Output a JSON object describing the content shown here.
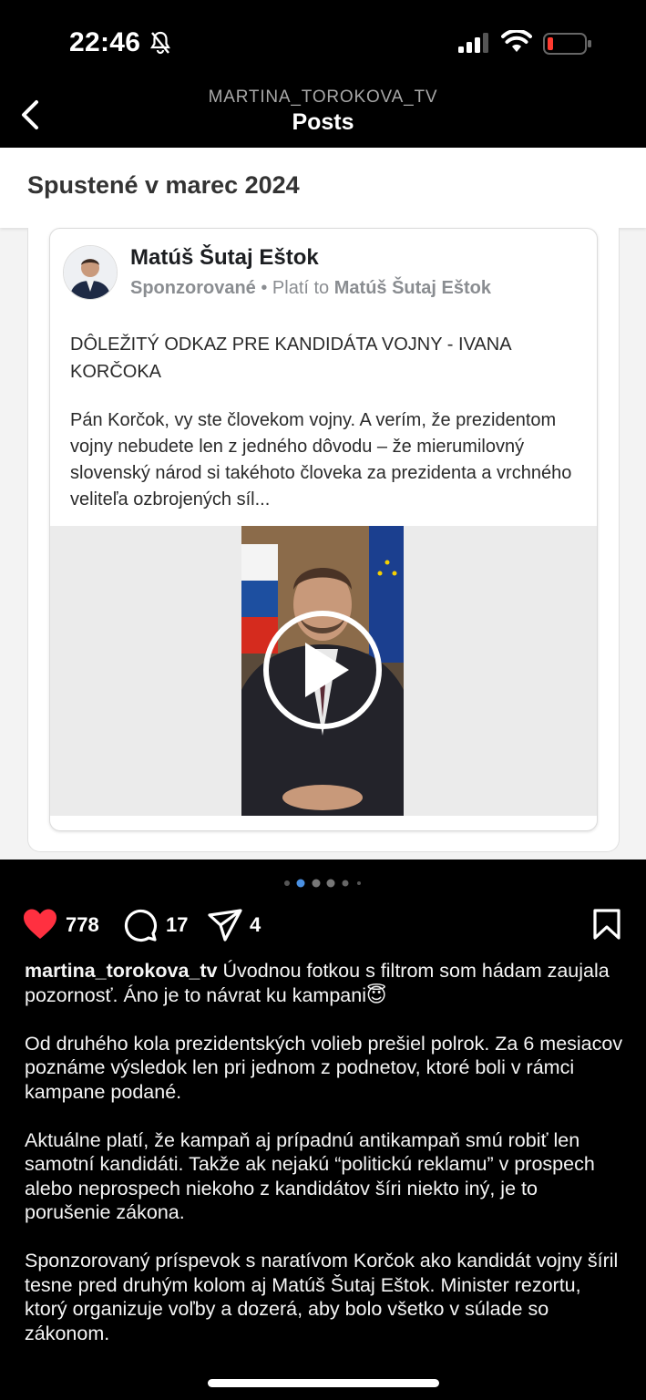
{
  "status_bar": {
    "time": "22:46"
  },
  "header": {
    "account": "MARTINA_TOROKOVA_TV",
    "title": "Posts"
  },
  "ad_preview": {
    "launched_label": "Spustené v marec 2024",
    "advertiser": "Matúš Šutaj Eštok",
    "sponsored": "Sponzorované",
    "paid_by_prefix": "• Platí to",
    "paid_by": "Matúš Šutaj Eštok",
    "headline": "DÔLEŽITÝ ODKAZ PRE KANDIDÁTA VOJNY - IVANA KORČOKA",
    "body": "Pán Korčok, vy ste človekom vojny. A verím, že prezidentom vojny nebudete len z jedného dôvodu – že mierumilovný slovenský národ si takéhoto človeka za prezidenta a vrchného veliteľa ozbrojených síl..."
  },
  "carousel": {
    "total": 6,
    "active_index": 1
  },
  "actions": {
    "likes": "778",
    "comments": "17",
    "shares": "4"
  },
  "caption": {
    "username": "martina_torokova_tv",
    "first_text": "Úvodnou fotkou s filtrom som hádam zaujala pozornosť. Áno je to návrat ku kampani😇",
    "paragraphs": [
      "Od druhého kola prezidentských volieb prešiel polrok. Za 6 mesiacov poznáme výsledok len pri jednom z podnetov, ktoré boli v rámci kampane podané.",
      "Aktuálne platí, že kampaň aj prípadnú antikampaň smú robiť len samotní kandidáti. Takže ak nejakú “politickú reklamu” v prospech alebo neprospech niekoho z kandidátov šíri niekto iný, je to porušenie zákona.",
      "Sponzorovaný príspevok s naratívom Korčok ako kandidát vojny šíril tesne pred druhým kolom aj Matúš Šutaj Eštok. Minister rezortu, ktorý organizuje voľby a dozerá, aby bolo všetko v súlade so zákonom."
    ]
  },
  "colors": {
    "like": "#ff3040",
    "dot_active": "#4a90e2"
  }
}
